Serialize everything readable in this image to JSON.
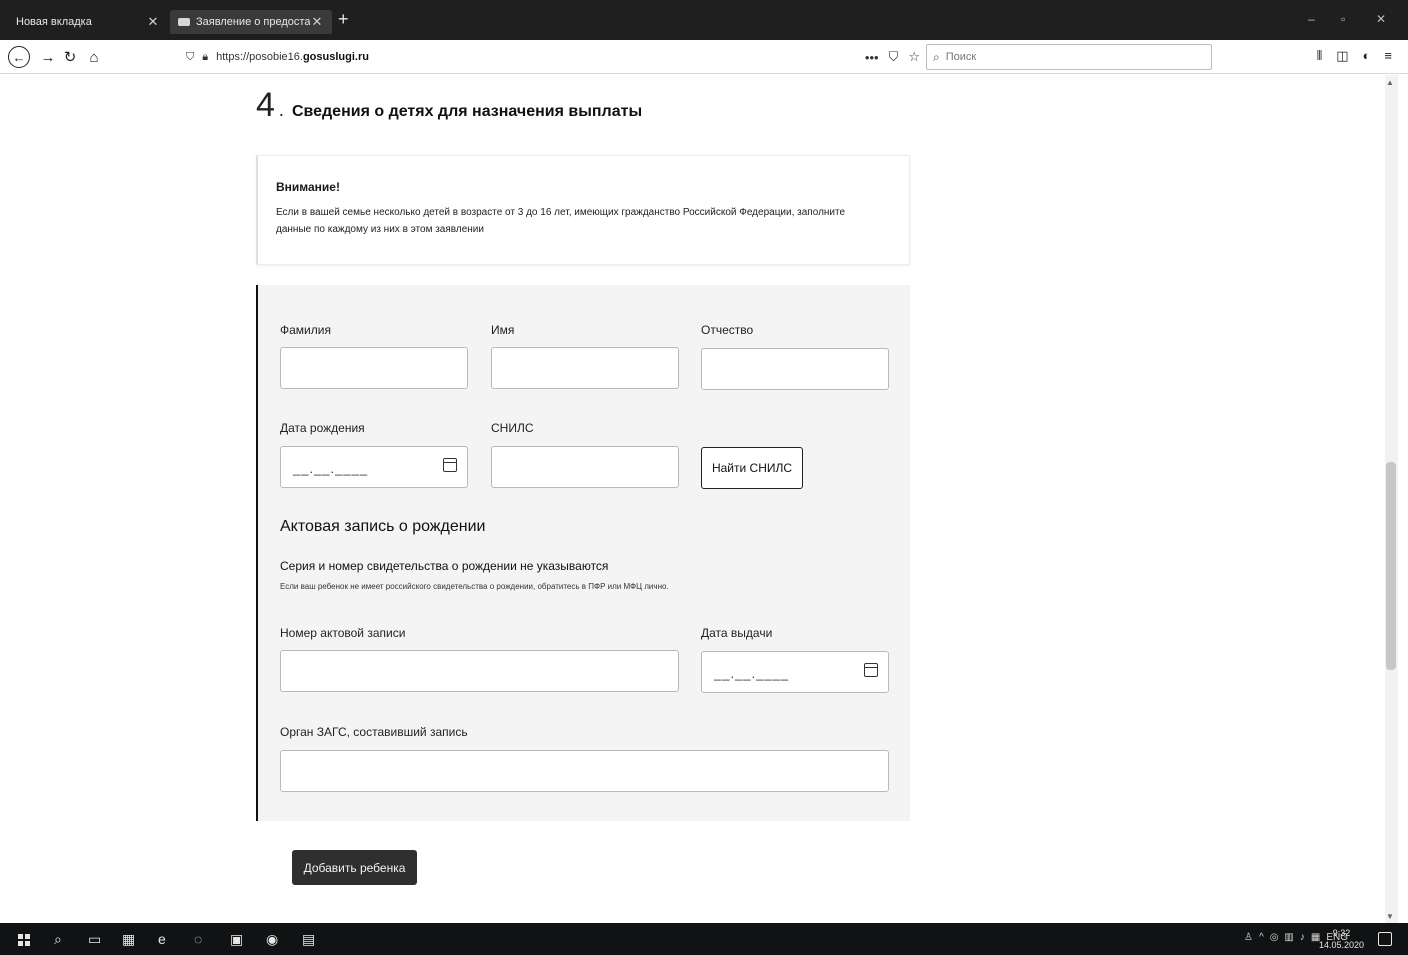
{
  "browser": {
    "tabs": [
      {
        "label": "Новая вкладка",
        "active": false
      },
      {
        "label": "Заявление о предоставлении",
        "active": true
      }
    ],
    "new_tab": "+",
    "url_prefix": "https://posobie16.",
    "url_domain": "gosuslugi.ru",
    "url_more": "•••",
    "search_placeholder": "Поиск"
  },
  "section": {
    "number": "4",
    "title": "Сведения о детях для назначения выплаты"
  },
  "notice": {
    "title": "Внимание!",
    "text": "Если в вашей семье несколько детей в возрасте от 3 до 16 лет, имеющих гражданство Российской Федерации, заполните данные по каждому из них в этом заявлении"
  },
  "form": {
    "surname_label": "Фамилия",
    "name_label": "Имя",
    "patronymic_label": "Отчество",
    "birthdate_label": "Дата рождения",
    "date_placeholder": "__.__.____",
    "snils_label": "СНИЛС",
    "find_snils_button": "Найти СНИЛС",
    "record_title": "Актовая запись о рождении",
    "record_note_title": "Серия и номер свидетельства о рождении не указываются",
    "record_note_text": "Если ваш ребенок не имеет российского свидетельства о рождении, обратитесь в ПФР или МФЦ лично.",
    "record_number_label": "Номер актовой записи",
    "issue_date_label": "Дата выдачи",
    "zags_label": "Орган ЗАГС, составивший запись",
    "add_child_button": "Добавить ребенка"
  },
  "taskbar": {
    "lang": "ENG",
    "time": "9:32",
    "date": "14.05.2020"
  }
}
